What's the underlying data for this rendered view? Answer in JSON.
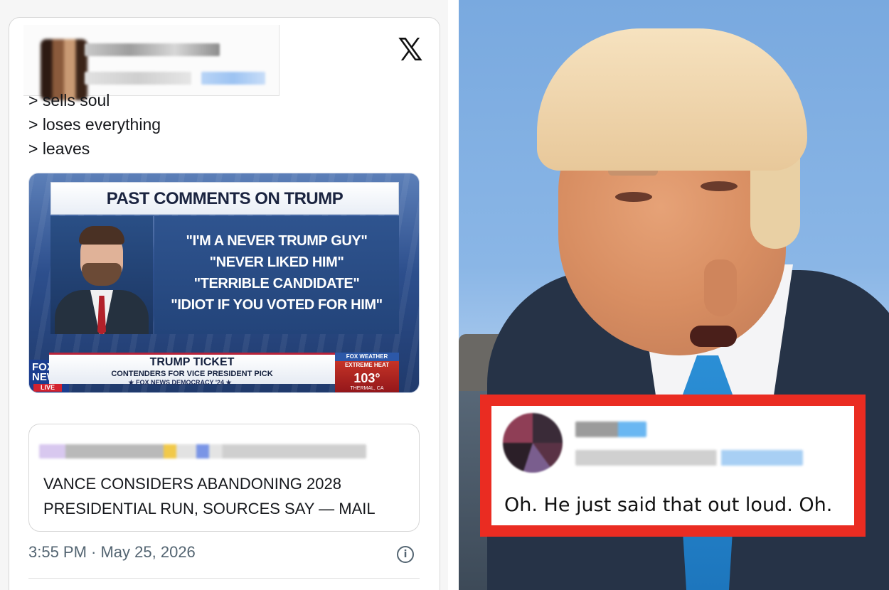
{
  "tweet": {
    "x_logo": "𝕏",
    "lines": [
      "> sells soul",
      "> loses everything",
      "> leaves"
    ],
    "timestamp": "3:55 PM · May 25, 2026",
    "info_icon": "i"
  },
  "tv_graphic": {
    "title": "PAST COMMENTS ON TRUMP",
    "quotes": [
      "\"I'M A NEVER TRUMP GUY\"",
      "\"NEVER LIKED HIM\"",
      "\"TERRIBLE CANDIDATE\"",
      "\"IDIOT IF YOU VOTED FOR HIM\""
    ],
    "lower_title": "TRUMP TICKET",
    "lower_subtitle": "CONTENDERS FOR VICE PRESIDENT PICK",
    "ticker": "★ FOX NEWS DEMOCRACY '24 ★",
    "logo": "FOX NEWS",
    "live": "LIVE",
    "weather_brand": "FOX WEATHER",
    "weather_label": "EXTREME HEAT",
    "weather_temp": "103°",
    "weather_location": "THERMAL, CA"
  },
  "quoted_tweet": {
    "text_lines": [
      "VANCE CONSIDERS ABANDONING 2028",
      "PRESIDENTIAL RUN, SOURCES SAY — MAIL"
    ]
  },
  "reply": {
    "text": "Oh. He just said that out loud. Oh."
  },
  "colors": {
    "reply_border": "#ea2c22",
    "tie": "#2b8fd6",
    "timestamp": "#536471"
  },
  "icons": [
    "x-logo-icon",
    "info-icon"
  ]
}
